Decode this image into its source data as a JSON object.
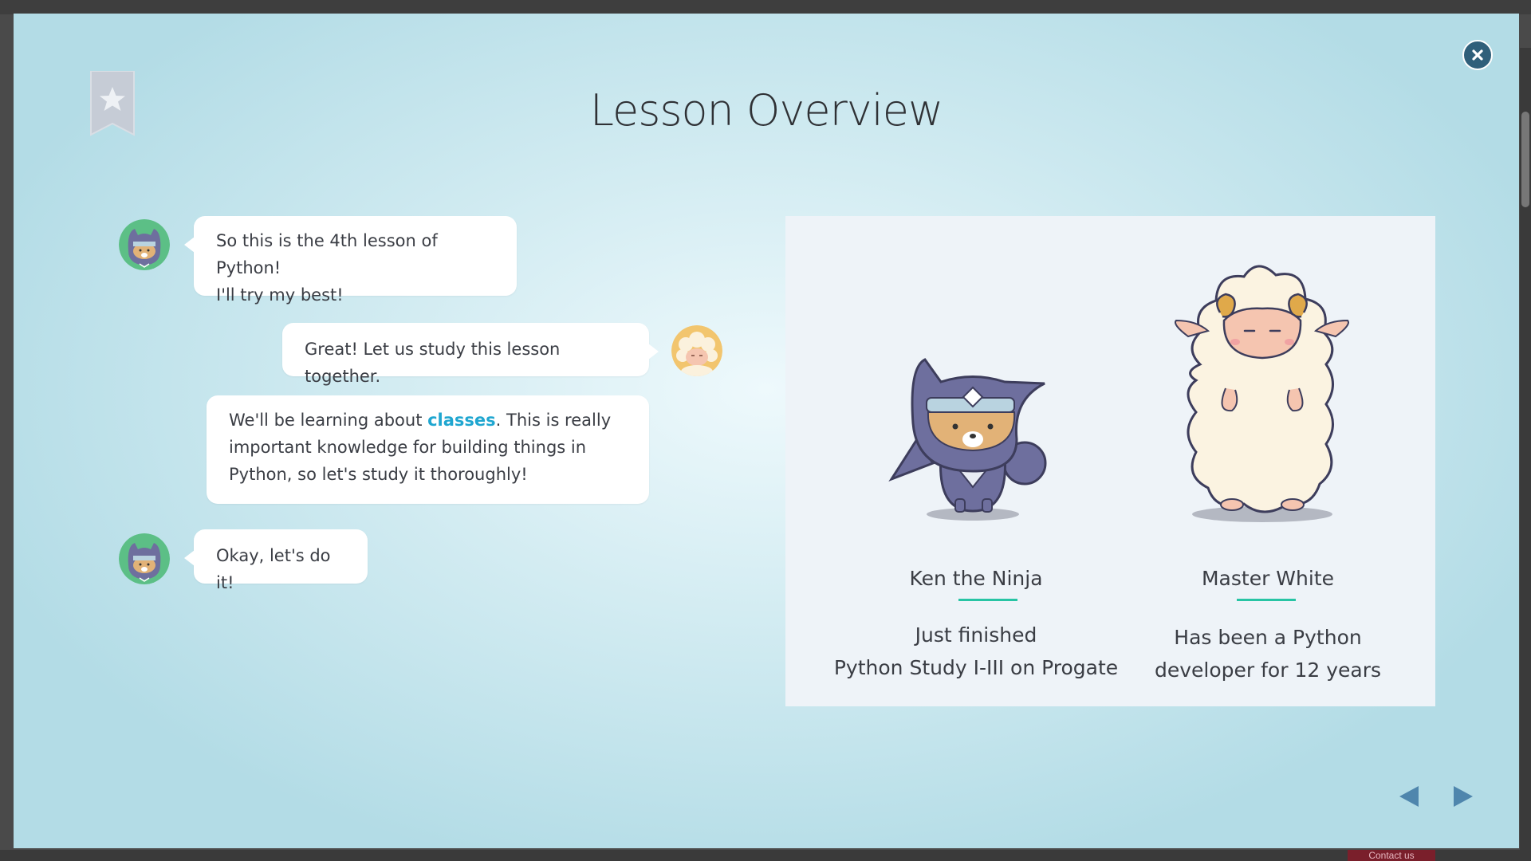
{
  "modal": {
    "title": "Lesson Overview",
    "close_icon": "close-icon",
    "bookmark_icon": "star-bookmark-icon"
  },
  "conversation": [
    {
      "speaker": "ken",
      "lines": [
        "So this is the 4th lesson of Python!",
        "I'll try my best!"
      ]
    },
    {
      "speaker": "master",
      "lines": [
        "Great! Let us study this lesson together."
      ]
    },
    {
      "speaker": "master",
      "text_before": "We'll be learning about ",
      "keyword": "classes",
      "text_after": ". This is really important knowledge for building things in Python, so let's study it thoroughly!"
    },
    {
      "speaker": "ken",
      "lines": [
        "Okay, let's do it!"
      ]
    }
  ],
  "characters": [
    {
      "name": "Ken the Ninja",
      "description_lines": [
        "Just finished",
        "Python Study I-III on Progate"
      ]
    },
    {
      "name": "Master White",
      "description_lines": [
        "Has been a Python",
        "developer for 12 years"
      ]
    }
  ],
  "navigation": {
    "prev_icon": "triangle-left-icon",
    "next_icon": "triangle-right-icon"
  },
  "backdrop": {
    "contact_label": "Contact us"
  },
  "colors": {
    "keyword": "#1fa6d0",
    "accent_underline": "#27c4a4",
    "close_button": "#2f5f7a",
    "nav_arrow": "#4f86ad"
  }
}
